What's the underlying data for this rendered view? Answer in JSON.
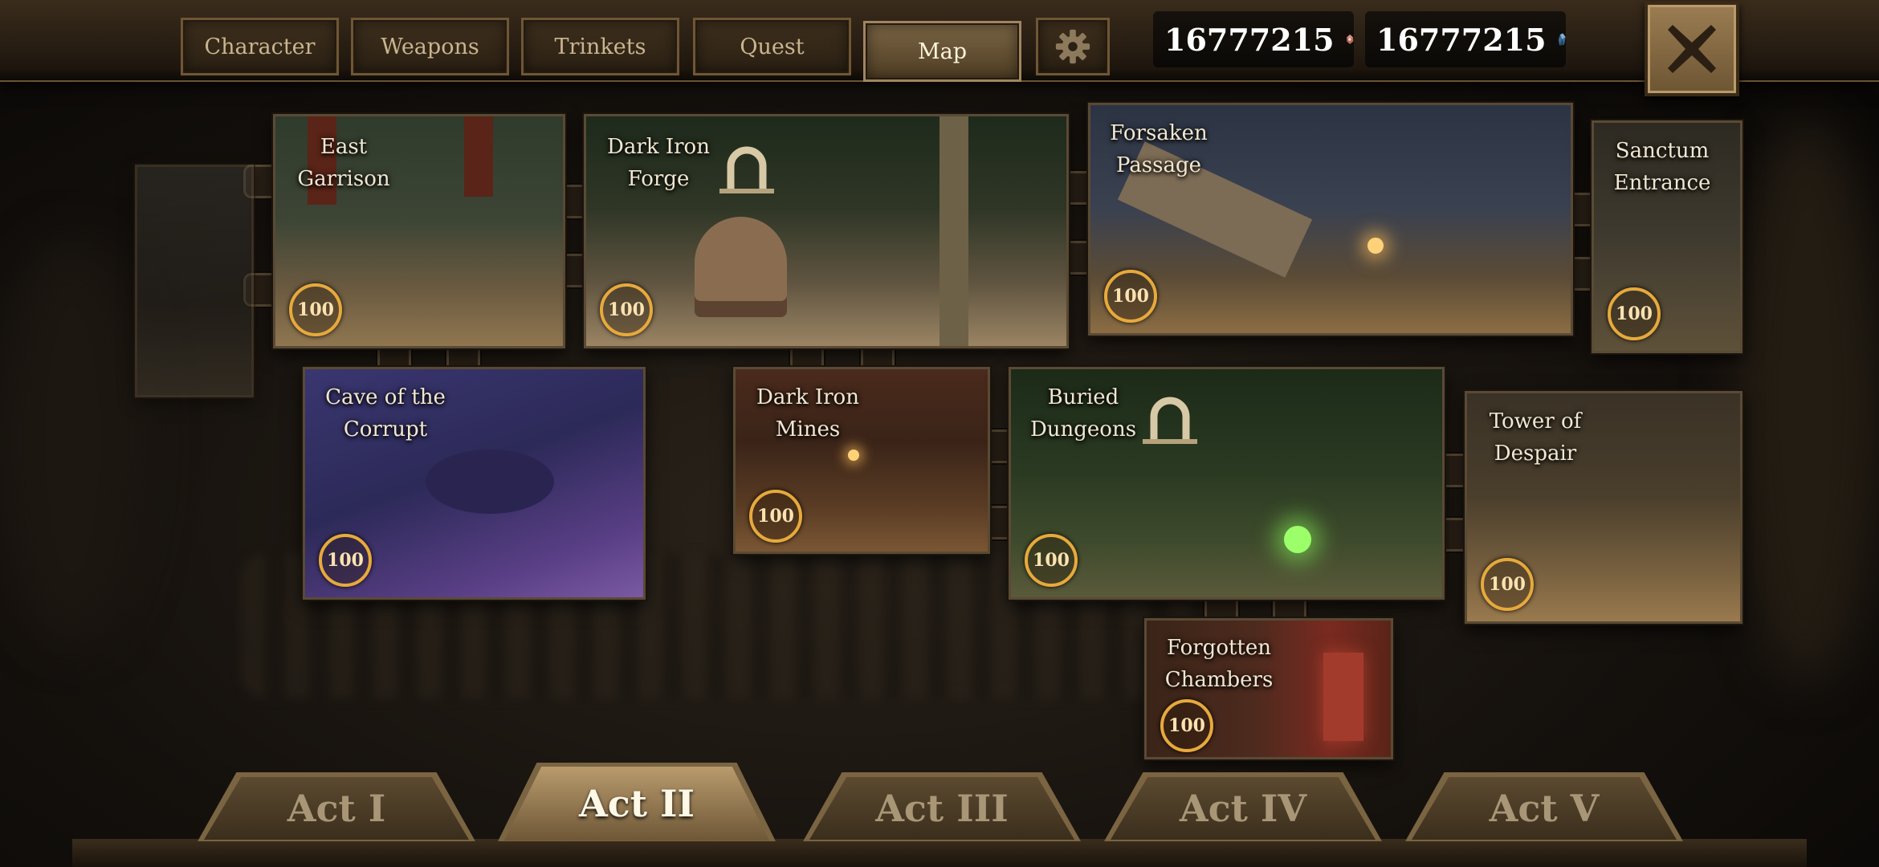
{
  "tabs": {
    "character": "Character",
    "weapons": "Weapons",
    "trinkets": "Trinkets",
    "quest": "Quest",
    "map": "Map"
  },
  "currency": {
    "soul": "16777215",
    "crystal": "16777215"
  },
  "tiles": {
    "east_garrison": {
      "title": "East\nGarrison",
      "score": "100"
    },
    "dark_iron_forge": {
      "title": "Dark Iron\nForge",
      "score": "100"
    },
    "forsaken_passage": {
      "title": "Forsaken\nPassage",
      "score": "100"
    },
    "sanctum_entrance": {
      "title": "Sanctum\nEntrance",
      "score": "100"
    },
    "cave_corrupt": {
      "title": "Cave of the\nCorrupt",
      "score": "100"
    },
    "dark_iron_mines": {
      "title": "Dark Iron\nMines",
      "score": "100"
    },
    "buried_dungeons": {
      "title": "Buried\nDungeons",
      "score": "100"
    },
    "tower_despair": {
      "title": "Tower of\nDespair",
      "score": "100"
    },
    "forgotten_chambers": {
      "title": "Forgotten\nChambers",
      "score": "100"
    }
  },
  "acts": [
    "Act I",
    "Act II",
    "Act III",
    "Act IV",
    "Act V"
  ],
  "active_act": "Act II",
  "colors": {
    "score_ring": "#e7a93c",
    "active_tab": "#7a6544"
  }
}
